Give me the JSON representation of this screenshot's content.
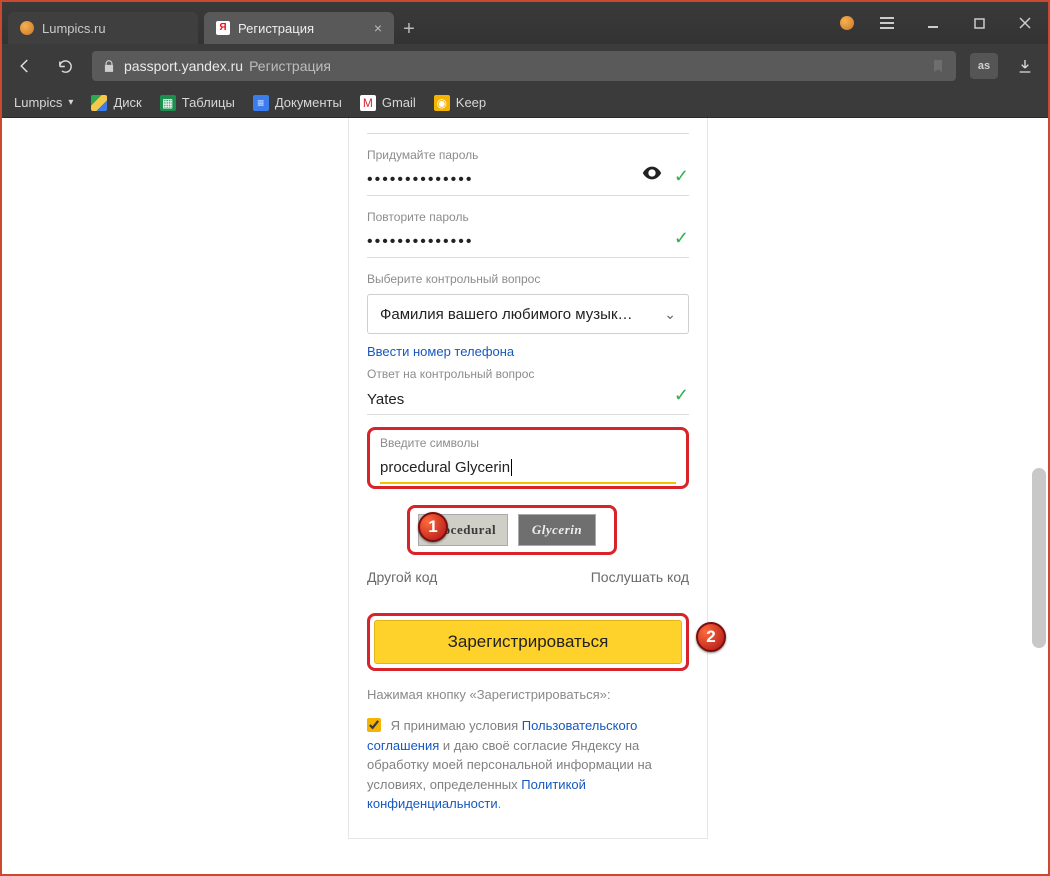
{
  "browser": {
    "tabs": [
      {
        "title": "Lumpics.ru",
        "active": false
      },
      {
        "title": "Регистрация",
        "active": true
      }
    ],
    "address": {
      "domain": "passport.yandex.ru",
      "path": "Регистрация"
    },
    "extension_label": "as",
    "bookmarks": {
      "lumpics": "Lumpics",
      "disk": "Диск",
      "sheets": "Таблицы",
      "docs": "Документы",
      "gmail": "Gmail",
      "keep": "Keep"
    }
  },
  "form": {
    "password_label": "Придумайте пароль",
    "password_value": "••••••••••••••",
    "repeat_label": "Повторите пароль",
    "repeat_value": "••••••••••••••",
    "question_label": "Выберите контрольный вопрос",
    "question_value": "Фамилия вашего любимого музык…",
    "phone_link": "Ввести номер телефона",
    "answer_label": "Ответ на контрольный вопрос",
    "answer_value": "Yates",
    "captcha_label": "Введите символы",
    "captcha_value": "procedural Glycerin",
    "captcha_words": {
      "w1": "procedural",
      "w2": "Glycerin"
    },
    "other_code": "Другой код",
    "listen_code": "Послушать код",
    "register": "Зарегистрироваться",
    "disclaimer": "Нажимая кнопку «Зарегистрироваться»:",
    "consent_prefix": "Я принимаю условия ",
    "consent_link1": "Пользовательского соглашения",
    "consent_mid": " и даю своё согласие Яндексу на обработку моей персональной информации на условиях, определенных ",
    "consent_link2": "Политикой конфиденциальности",
    "consent_suffix": "."
  },
  "markers": {
    "one": "1",
    "two": "2"
  }
}
